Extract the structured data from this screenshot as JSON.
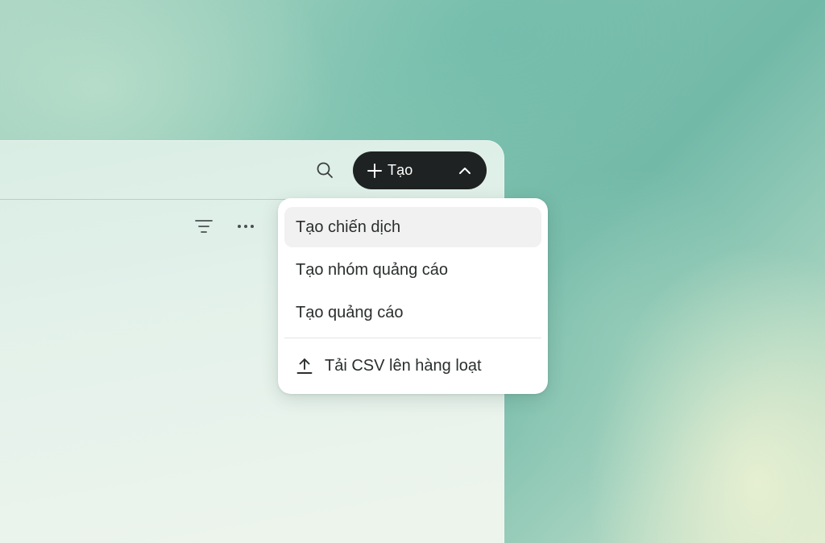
{
  "header": {
    "search_icon": "search-icon",
    "create_button": {
      "label": "Tạo",
      "icon_left": "plus-icon",
      "icon_right": "chevron-up-icon"
    }
  },
  "toolbar": {
    "filter_icon": "filter-icon",
    "more_icon": "more-horizontal-icon"
  },
  "create_menu": {
    "items": [
      {
        "label": "Tạo chiến dịch",
        "highlighted": true
      },
      {
        "label": "Tạo nhóm quảng cáo"
      },
      {
        "label": "Tạo quảng cáo"
      }
    ],
    "upload_item": {
      "label": "Tải CSV lên hàng loạt",
      "icon": "upload-icon"
    }
  },
  "colors": {
    "button_bg": "#1f2222",
    "menu_bg": "#ffffff",
    "menu_highlight": "#f1f1f1",
    "text": "#2b2e2e"
  }
}
